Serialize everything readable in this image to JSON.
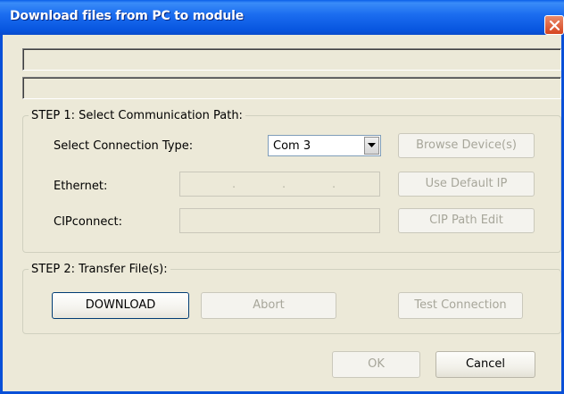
{
  "window": {
    "title": "Download files from PC to module"
  },
  "step1": {
    "legend": "STEP 1: Select Communication Path:",
    "connection_type_label": "Select Connection Type:",
    "connection_type_value": "Com 3",
    "ethernet_label": "Ethernet:",
    "ethernet_dots": [
      ".",
      ".",
      "."
    ],
    "cipconnect_label": "CIPconnect:",
    "browse_button": "Browse Device(s)",
    "default_ip_button": "Use Default IP",
    "cip_path_button": "CIP Path Edit"
  },
  "step2": {
    "legend": "STEP 2: Transfer File(s):",
    "download_button": "DOWNLOAD",
    "abort_button": "Abort",
    "test_button": "Test Connection"
  },
  "footer": {
    "ok_button": "OK",
    "cancel_button": "Cancel"
  },
  "icons": {
    "close": "close-icon",
    "dropdown": "chevron-down-icon"
  }
}
